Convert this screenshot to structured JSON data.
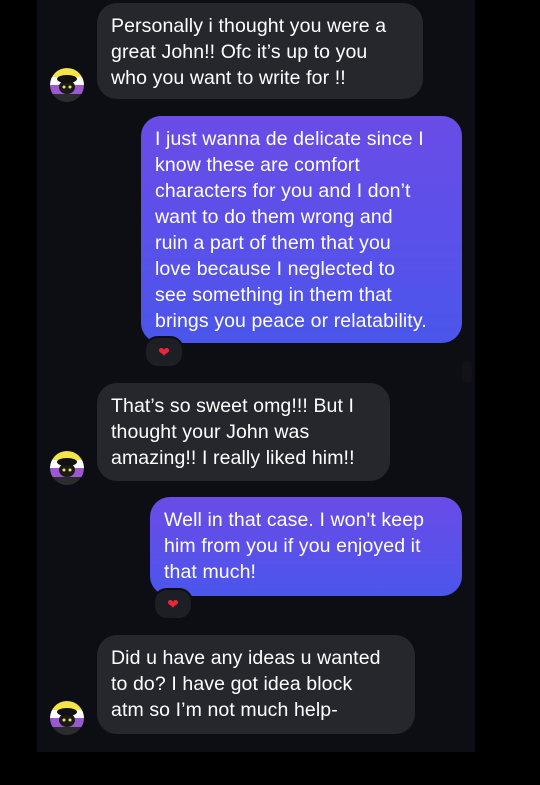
{
  "messages": [
    {
      "id": "m1",
      "direction": "in",
      "text": "Personally i thought you were a\ngreat John!! Ofc it’s up to you\nwho you want to write for !!"
    },
    {
      "id": "m2",
      "direction": "out",
      "text": "I just wanna de delicate since I\nknow these are comfort\ncharacters for you and I don’t\nwant to do them wrong and\nruin a part of them that you\nlove because I neglected to\nsee something in them that\nbrings you peace or relatability.",
      "reaction": "❤"
    },
    {
      "id": "m3",
      "direction": "in",
      "text": "That’s so sweet omg!!! But I\nthought your John was\namazing!! I really liked him!!"
    },
    {
      "id": "m4",
      "direction": "out",
      "text": "Well in that case. I won't keep\nhim from you if you enjoyed it\nthat much!",
      "reaction": "❤"
    },
    {
      "id": "m5",
      "direction": "in",
      "text": "Did u have any ideas u wanted\nto do? I have got idea block\natm so I’m not much help-"
    }
  ],
  "colors": {
    "background": "#000000",
    "chat_background": "#0d0e13",
    "incoming_bubble": "#26272d",
    "outgoing_gradient_top": "#6a4ce6",
    "outgoing_gradient_bottom": "#4a56ea",
    "reaction_heart": "#e8283a"
  },
  "icons": {
    "avatar": "nonbinary-flag-avatar-icon",
    "reaction": "red-heart-icon"
  }
}
